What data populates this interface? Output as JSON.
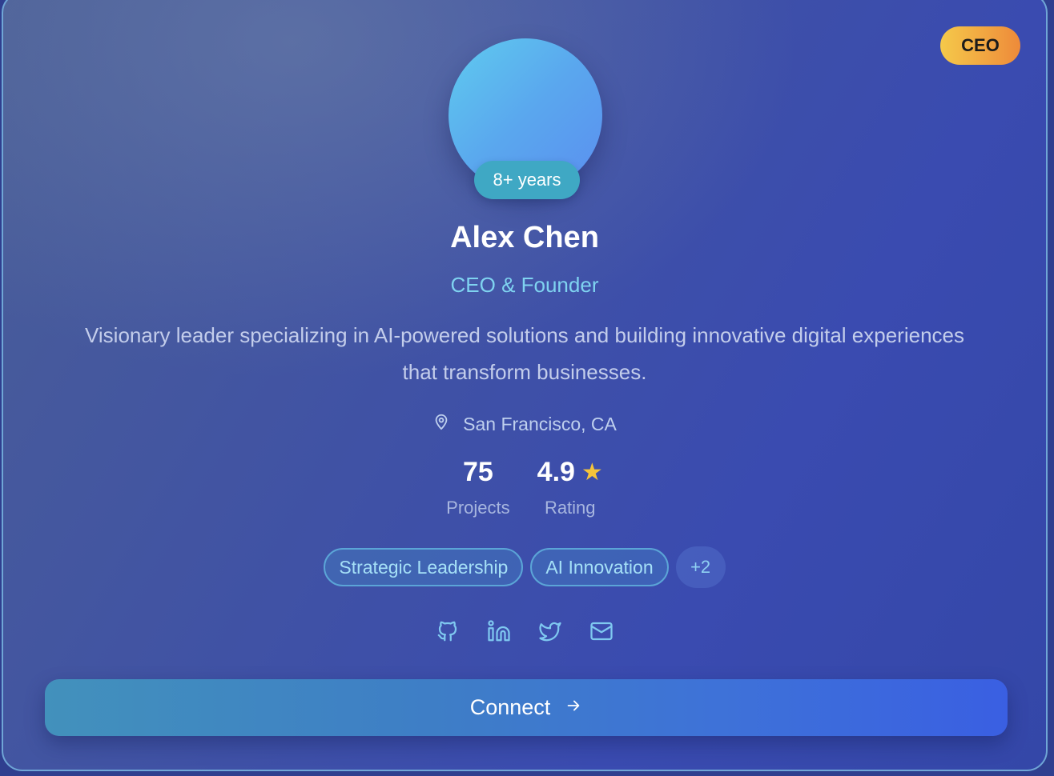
{
  "profile": {
    "role_badge": "CEO",
    "experience": "8+ years",
    "name": "Alex Chen",
    "title": "CEO & Founder",
    "bio": "Visionary leader specializing in AI-powered solutions and building innovative digital experiences that transform businesses.",
    "location": "San Francisco, CA"
  },
  "stats": {
    "projects_value": "75",
    "projects_label": "Projects",
    "rating_value": "4.9",
    "rating_label": "Rating"
  },
  "tags": {
    "items": [
      "Strategic Leadership",
      "AI Innovation"
    ],
    "more": "+2"
  },
  "social": {
    "icons": [
      "github-icon",
      "linkedin-icon",
      "twitter-icon",
      "mail-icon"
    ]
  },
  "actions": {
    "connect_label": "Connect"
  },
  "colors": {
    "accent_cyan": "#7fd3f0",
    "badge_gradient_start": "#f5c94a",
    "badge_gradient_end": "#ee8a3a",
    "star": "#f5c43a",
    "button_start": "#4291bc",
    "button_end": "#3a5fe2"
  }
}
